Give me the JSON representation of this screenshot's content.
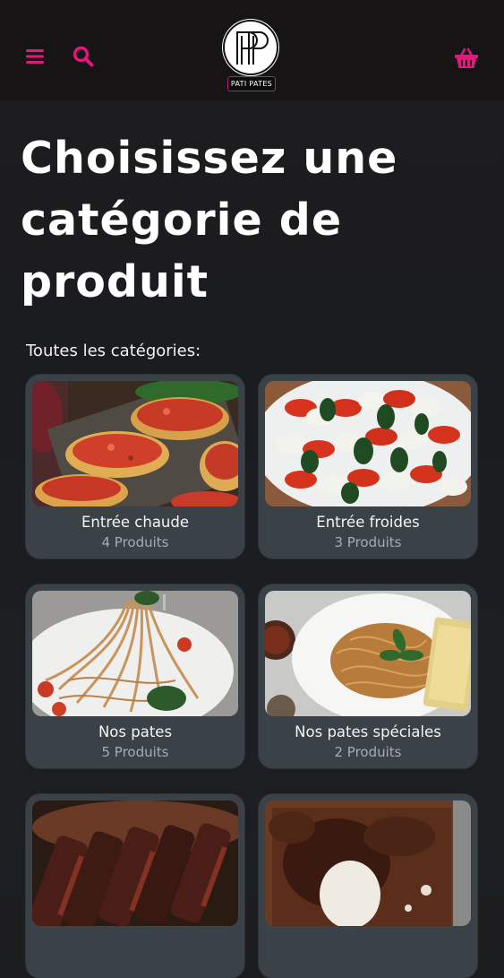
{
  "header": {
    "logo_badge_text": "PATI PATES",
    "accent_color": "#e0197d"
  },
  "page": {
    "title": "Choisissez une catégorie de produit",
    "section_label": "Toutes les catégories:"
  },
  "categories": [
    {
      "name": "Entrée chaude",
      "count": "4 Produits"
    },
    {
      "name": "Entrée froides",
      "count": "3 Produits"
    },
    {
      "name": "Nos pates",
      "count": "5 Produits"
    },
    {
      "name": "Nos pates spéciales",
      "count": "2 Produits"
    },
    {
      "name": "",
      "count": ""
    },
    {
      "name": "",
      "count": ""
    }
  ]
}
